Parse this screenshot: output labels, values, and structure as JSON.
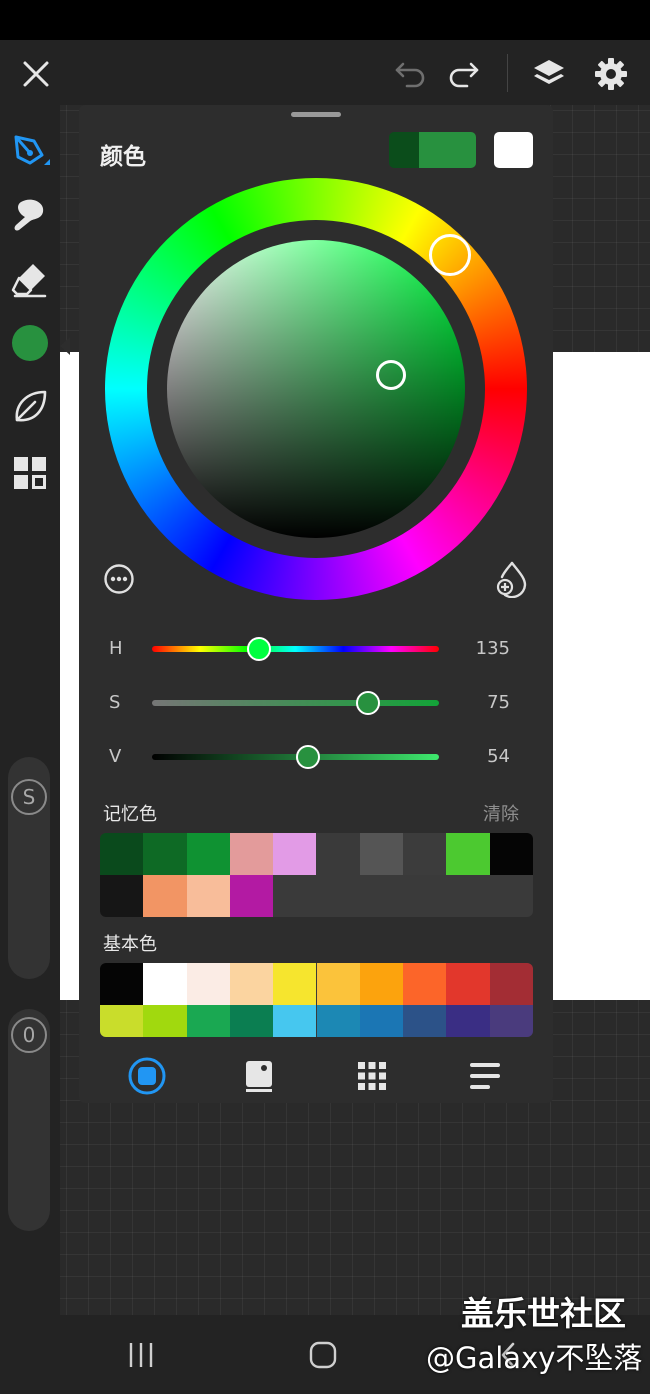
{
  "app": {
    "accent": "#2196f3",
    "current_color": "#28913f"
  },
  "topbar": {
    "icons": [
      "close-icon",
      "undo-icon",
      "redo-icon",
      "layers-icon",
      "gear-icon"
    ]
  },
  "toolbar": {
    "tools": [
      "pen-icon",
      "brush-icon",
      "eraser-icon",
      "color-icon",
      "leaf-icon",
      "grid-icon"
    ],
    "pill_top_badge": "S",
    "pill_bottom_badge": "0"
  },
  "panel": {
    "title": "颜色",
    "previous_color": "#0b4d1b",
    "current_color": "#28913f",
    "background_color": "#ffffff",
    "hsv": [
      {
        "label": "H",
        "value": "135",
        "fraction": 0.375
      },
      {
        "label": "S",
        "value": "75",
        "fraction": 0.75
      },
      {
        "label": "V",
        "value": "54",
        "fraction": 0.54
      }
    ],
    "recent": {
      "label": "记忆色",
      "clear_label": "清除",
      "colors": [
        "#0a4a1c",
        "#0e6a25",
        "#0f9232",
        "#e39b9b",
        "#e29be6",
        "#3a3a3a",
        "#555555",
        "#3c3c3c",
        "#4cc930",
        "#050505",
        "#161616",
        "#f29564",
        "#f8bd9a",
        "#b31aa3"
      ]
    },
    "basic": {
      "label": "基本色",
      "colors": [
        "#050505",
        "#ffffff",
        "#fbece5",
        "#fbd4a0",
        "#f6e52e",
        "#fbc33b",
        "#fca30d",
        "#fc6529",
        "#e2372c",
        "#a32d34",
        "#c9dd2b",
        "#a1d90e",
        "#1aa852",
        "#0b7e51",
        "#46c7ef",
        "#1c88b4",
        "#1b76b4",
        "#2c5288",
        "#3a2e84",
        "#4a3b7d"
      ]
    },
    "tabs": [
      "disc-tab-icon",
      "classic-tab-icon",
      "palette-grid-tab-icon",
      "value-list-tab-icon"
    ]
  },
  "navbar": {
    "buttons": [
      "recent-apps-icon",
      "home-icon",
      "back-icon"
    ]
  },
  "watermark": {
    "line1": "盖乐世社区",
    "line2": "@Galaxy不坠落"
  }
}
